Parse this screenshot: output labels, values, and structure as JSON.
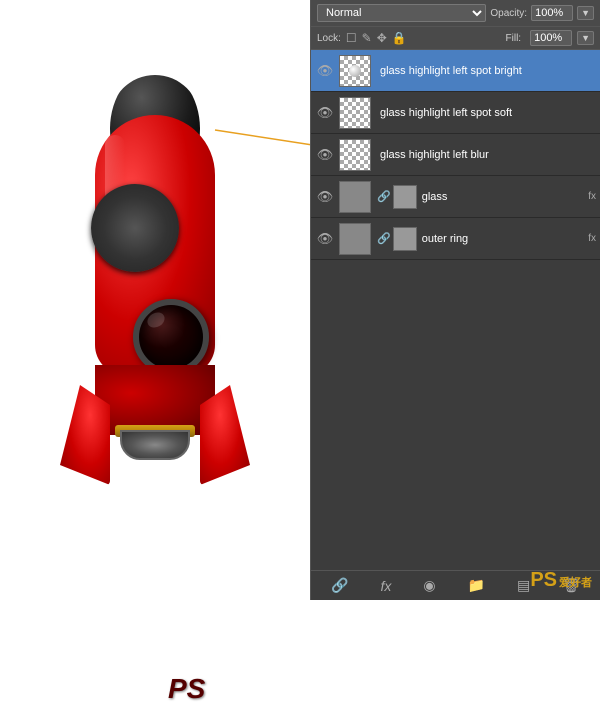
{
  "panel": {
    "blend_mode_label": "Normal",
    "opacity_label": "Opacity:",
    "opacity_value": "100%",
    "lock_label": "Lock:",
    "fill_label": "Fill:",
    "fill_value": "100%",
    "layers": [
      {
        "id": 0,
        "name": "glass highlight left spot bright",
        "selected": true,
        "visible": true,
        "thumb_type": "checker_dot",
        "has_fx": false,
        "has_link": false
      },
      {
        "id": 1,
        "name": "glass highlight left spot soft",
        "selected": false,
        "visible": true,
        "thumb_type": "checker",
        "has_fx": false,
        "has_link": false
      },
      {
        "id": 2,
        "name": "glass highlight left blur",
        "selected": false,
        "visible": true,
        "thumb_type": "checker",
        "has_fx": false,
        "has_link": false
      },
      {
        "id": 3,
        "name": "glass",
        "selected": false,
        "visible": true,
        "thumb_type": "solid",
        "has_fx": true,
        "has_link": true
      },
      {
        "id": 4,
        "name": "outer ring",
        "selected": false,
        "visible": true,
        "thumb_type": "solid",
        "has_fx": true,
        "has_link": true
      }
    ],
    "bottom_icons": [
      "link-icon",
      "fx-icon",
      "mask-icon",
      "folder-icon",
      "adjustment-icon",
      "trash-icon"
    ]
  },
  "watermark": {
    "text": "PS",
    "subtext": "爱好者"
  },
  "rocket": {
    "ps_text": "PS"
  },
  "annotations": {
    "arrow1_color": "#e8a020",
    "arrow2_color": "#e8a020"
  }
}
